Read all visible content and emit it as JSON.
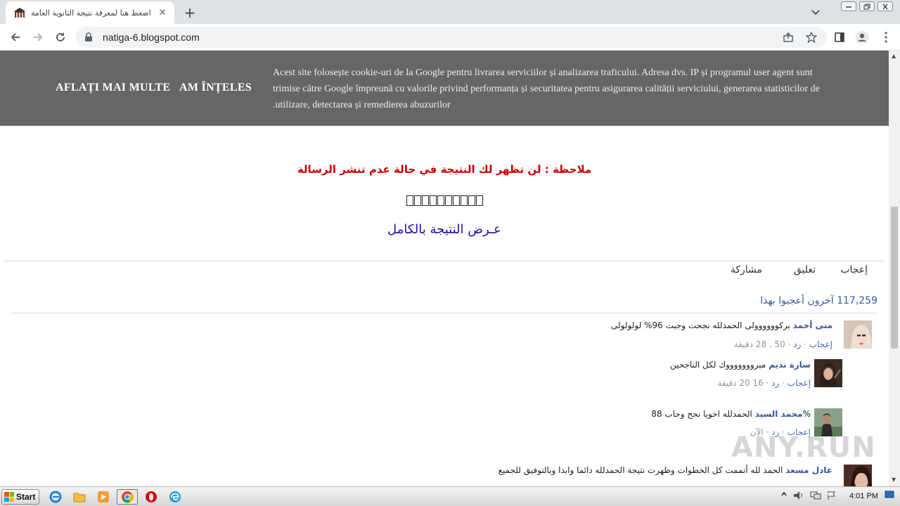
{
  "browser": {
    "tab_title": "اضغط هنا لمعرفة نتيجة الثانوية العامة",
    "tab_close": "✕",
    "new_tab": "+",
    "url": "natiga-6.blogspot.com"
  },
  "cookie_banner": {
    "text": "Acest site folosește cookie-uri de la Google pentru livrarea serviciilor și analizarea traficului. Adresa dvs. IP și programul user agent sunt trimise către Google împreună cu valorile privind performanța și securitatea pentru asigurarea calității serviciului, generarea statisticilor de utilizare, detectarea și remedierea abuzurilor.",
    "learn_more": "AFLAȚI MAI MULTE",
    "accept": "AM ÎNȚELES"
  },
  "page": {
    "note": "ملاحظة : لن تظهر لك النتيجة في حالة عدم تنشر الرسالة",
    "boxes_count": 10,
    "full_result_link": "عـرض النتيجة بالكامل"
  },
  "actions": {
    "like": "إعجاب",
    "comment": "تعليق",
    "share": "مشاركة"
  },
  "likes": {
    "count": "117,259",
    "text": "آخرون أعجبوا بهذا"
  },
  "comments": [
    {
      "name": "منى أحمد",
      "text": "بركوووووولى الحمدلله نجحت وجبت 96% لولولولى",
      "like": "إعجاب",
      "reply": "رد",
      "likes": "50",
      "time": "28 دقيقة"
    },
    {
      "name": "سارة نديم",
      "text": "مبروووووووك لكل الناجحين",
      "like": "إعجاب",
      "reply": "رد",
      "likes": "16",
      "time": "20 دقيقة"
    },
    {
      "name": "محمد السيد",
      "text": "الحمدلله اخويا نجح وجاب 88%",
      "like": "إعجاب",
      "reply": "رد",
      "likes": "",
      "time": "الآن"
    },
    {
      "name": "عادل مسعد",
      "text": "الحمد لله أتممت كل الخطوات وظهرت نتيجة الحمدلله دائما وابدا وبالتوفيق للجميع",
      "like": "",
      "reply": "",
      "likes": "",
      "time": ""
    }
  ],
  "watermark": "ANY.RUN",
  "taskbar": {
    "start": "Start",
    "clock": "4:01 PM"
  },
  "colors": {
    "cookie_bg": "#666666",
    "note_red": "#cc0000",
    "link_blue": "#1a0dab",
    "fb_blue": "#365899"
  }
}
